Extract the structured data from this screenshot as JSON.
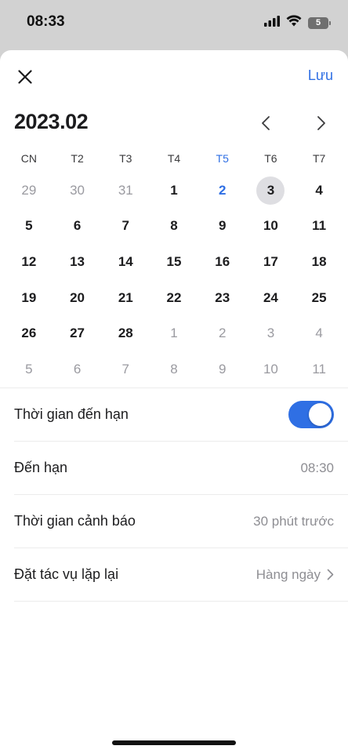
{
  "status": {
    "time": "08:33",
    "battery": "5"
  },
  "header": {
    "save_label": "Lưu",
    "month_title": "2023.02"
  },
  "weekdays": [
    "CN",
    "T2",
    "T3",
    "T4",
    "T5",
    "T6",
    "T7"
  ],
  "days": [
    {
      "d": "29",
      "muted": true
    },
    {
      "d": "30",
      "muted": true
    },
    {
      "d": "31",
      "muted": true
    },
    {
      "d": "1"
    },
    {
      "d": "2",
      "today": true
    },
    {
      "d": "3",
      "selected": true
    },
    {
      "d": "4"
    },
    {
      "d": "5"
    },
    {
      "d": "6"
    },
    {
      "d": "7"
    },
    {
      "d": "8"
    },
    {
      "d": "9"
    },
    {
      "d": "10"
    },
    {
      "d": "11"
    },
    {
      "d": "12"
    },
    {
      "d": "13"
    },
    {
      "d": "14"
    },
    {
      "d": "15"
    },
    {
      "d": "16"
    },
    {
      "d": "17"
    },
    {
      "d": "18"
    },
    {
      "d": "19"
    },
    {
      "d": "20"
    },
    {
      "d": "21"
    },
    {
      "d": "22"
    },
    {
      "d": "23"
    },
    {
      "d": "24"
    },
    {
      "d": "25"
    },
    {
      "d": "26"
    },
    {
      "d": "27"
    },
    {
      "d": "28"
    },
    {
      "d": "1",
      "muted": true
    },
    {
      "d": "2",
      "muted": true
    },
    {
      "d": "3",
      "muted": true
    },
    {
      "d": "4",
      "muted": true
    },
    {
      "d": "5",
      "muted": true
    },
    {
      "d": "6",
      "muted": true
    },
    {
      "d": "7",
      "muted": true
    },
    {
      "d": "8",
      "muted": true
    },
    {
      "d": "9",
      "muted": true
    },
    {
      "d": "10",
      "muted": true
    },
    {
      "d": "11",
      "muted": true
    }
  ],
  "settings": {
    "due_time_toggle": {
      "label": "Thời gian đến hạn",
      "on": true
    },
    "due": {
      "label": "Đến hạn",
      "value": "08:30"
    },
    "reminder": {
      "label": "Thời gian cảnh báo",
      "value": "30 phút trước"
    },
    "repeat": {
      "label": "Đặt tác vụ lặp lại",
      "value": "Hàng ngày"
    }
  },
  "colors": {
    "accent": "#2f6fe4",
    "muted": "#9a9aa0",
    "selected_bg": "#dedee2"
  }
}
